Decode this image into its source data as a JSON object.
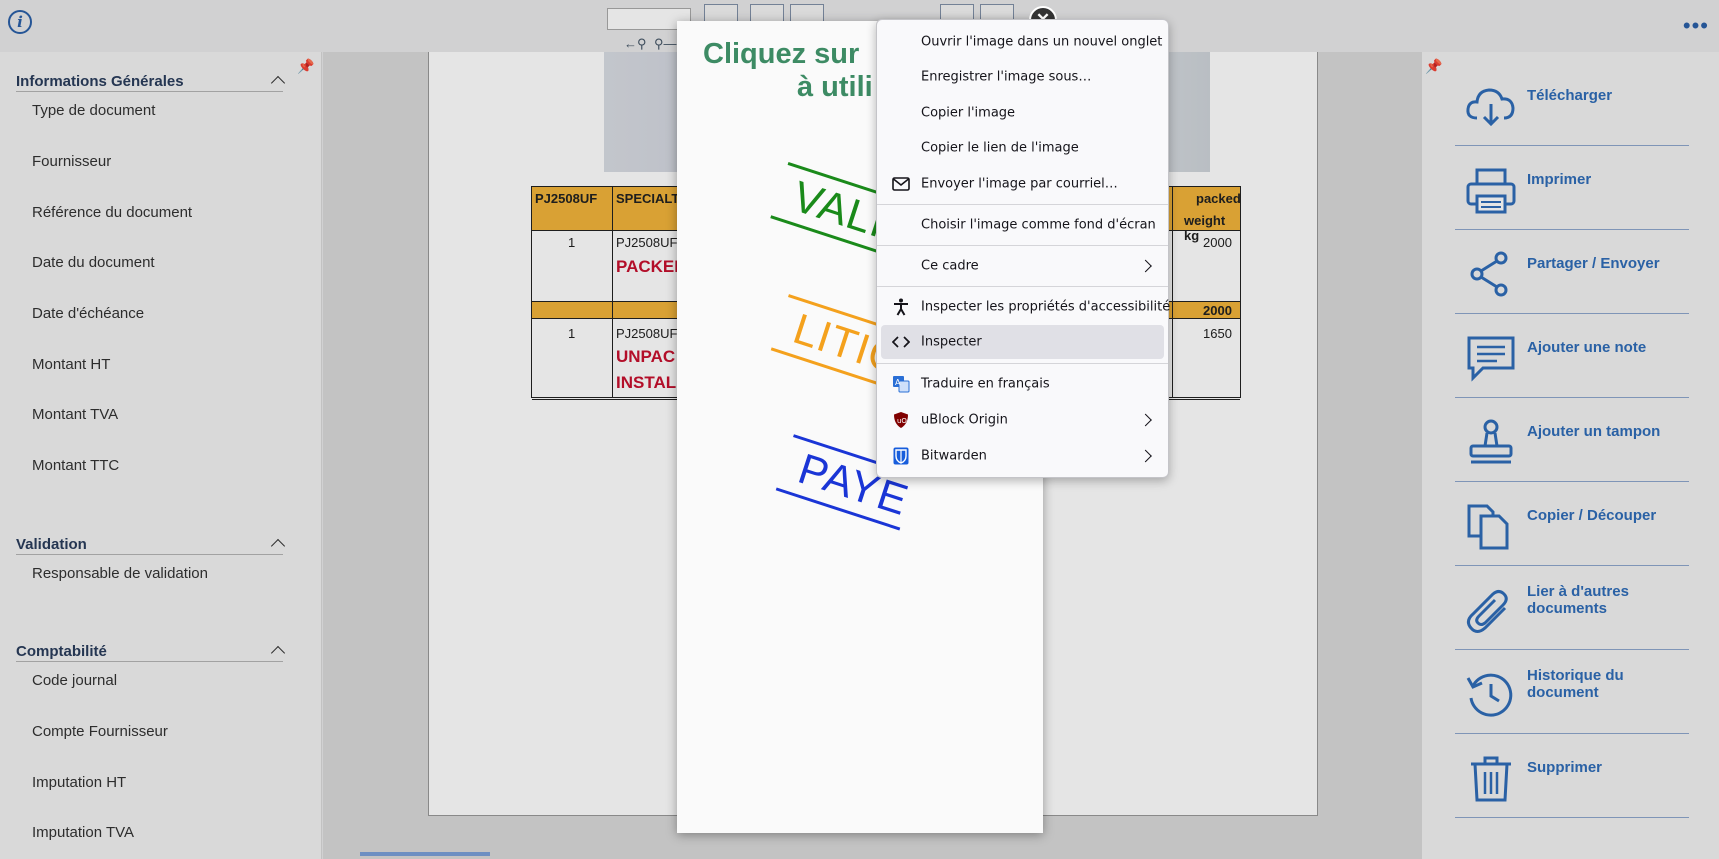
{
  "left_panel": {
    "sections": [
      {
        "title": "Informations Générales",
        "fields": [
          "Type de document",
          "Fournisseur",
          "Référence du document",
          "Date du document",
          "Date d'échéance",
          "Montant HT",
          "Montant TVA",
          "Montant TTC"
        ]
      },
      {
        "title": "Validation",
        "fields": [
          "Responsable de validation"
        ]
      },
      {
        "title": "Comptabilité",
        "fields": [
          "Code journal",
          "Compte Fournisseur",
          "Imputation HT",
          "Imputation TVA"
        ]
      }
    ]
  },
  "document": {
    "hdr_col1": "PJ2508UF",
    "hdr_col2": "SPECIALT",
    "hdr_col_last_1": "packed",
    "hdr_col_last_2": "weight kg",
    "row1_qty": "1",
    "row1_ref": "PJ2508UF",
    "row1_desc": "PACKEI",
    "row1_weight": "2000",
    "subtotal": "2000",
    "row2_qty": "1",
    "row2_ref": "PJ2508UF",
    "row2_desc1": "UNPAC",
    "row2_desc2": "INSTAL",
    "row2_weight": "1650"
  },
  "modal": {
    "title_line1": "Cliquez sur",
    "title_line2": "à utili",
    "stamps": [
      {
        "label": "VALI",
        "color": "#1a8a1a"
      },
      {
        "label": "LITIG",
        "color": "#f4a11d"
      },
      {
        "label": "PAYE",
        "color": "#1a35d6"
      }
    ]
  },
  "context_menu": {
    "items": [
      {
        "label": "Ouvrir l'image dans un nouvel onglet",
        "icon": "",
        "submenu": false
      },
      {
        "label": "Enregistrer l'image sous…",
        "icon": "",
        "submenu": false
      },
      {
        "label": "Copier l'image",
        "icon": "",
        "submenu": false
      },
      {
        "label": "Copier le lien de l'image",
        "icon": "",
        "submenu": false
      },
      {
        "label": "Envoyer l'image par courriel…",
        "icon": "mail-icon",
        "submenu": false
      },
      {
        "label": "Choisir l'image comme fond d'écran",
        "icon": "",
        "submenu": false
      },
      {
        "label": "Ce cadre",
        "icon": "",
        "submenu": true
      },
      {
        "label": "Inspecter les propriétés d'accessibilité",
        "icon": "accessibility-icon",
        "submenu": false
      },
      {
        "label": "Inspecter",
        "icon": "code-icon",
        "submenu": false,
        "highlighted": true
      },
      {
        "label": "Traduire en français",
        "icon": "translate-icon",
        "submenu": false
      },
      {
        "label": "uBlock Origin",
        "icon": "ublock-icon",
        "submenu": true
      },
      {
        "label": "Bitwarden",
        "icon": "bitwarden-icon",
        "submenu": true
      }
    ]
  },
  "right_panel": {
    "actions": [
      {
        "label": "Télécharger",
        "icon": "cloud-download-icon"
      },
      {
        "label": "Imprimer",
        "icon": "printer-icon"
      },
      {
        "label": "Partager / Envoyer",
        "icon": "share-icon"
      },
      {
        "label": "Ajouter une note",
        "icon": "note-icon"
      },
      {
        "label": "Ajouter un tampon",
        "icon": "stamp-icon"
      },
      {
        "label": "Copier / Découper",
        "icon": "copy-icon"
      },
      {
        "label": "Lier à d'autres documents",
        "icon": "paperclip-icon"
      },
      {
        "label": "Historique du document",
        "icon": "history-icon"
      },
      {
        "label": "Supprimer",
        "icon": "trash-icon"
      }
    ]
  },
  "colors": {
    "accent_blue": "#2f6db8",
    "modal_title_green": "#3d8b64",
    "table_header_orange": "#f2b43a",
    "table_red_text": "#c8102e"
  }
}
